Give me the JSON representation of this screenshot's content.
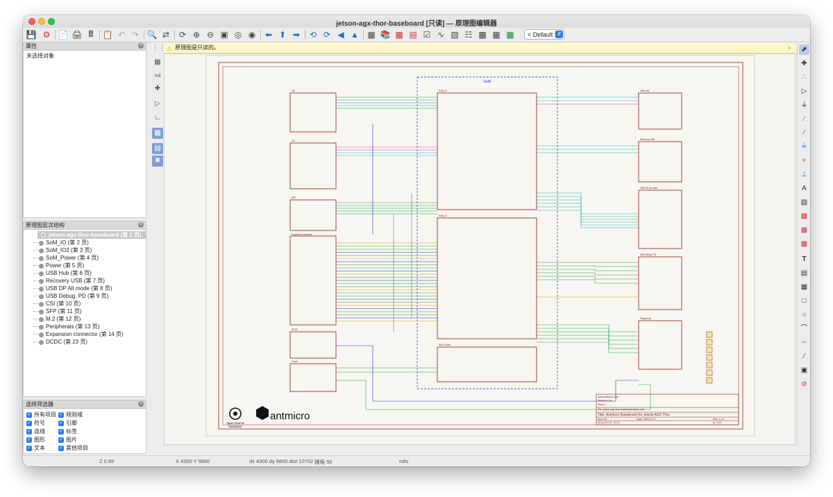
{
  "window": {
    "title": "jetson-agx-thor-baseboard [只读] — 原理图编辑器"
  },
  "toolbar": {
    "layer_select": "< Default >"
  },
  "properties": {
    "title": "属性",
    "empty_text": "未选择对象"
  },
  "hierarchy": {
    "title": "原理图层次结构",
    "root": "jetson-agx-thor-baseboard (第 1 页)",
    "items": [
      "SoM_IO (第 2 页)",
      "SoM_IO2 (第 3 页)",
      "SoM_Power (第 4 页)",
      "Power (第 5 页)",
      "USB Hub (第 6 页)",
      "Recovery USB (第 7 页)",
      "USB DP Alt mode (第 8 页)",
      "USB Debug, PD (第 9 页)",
      "CSI (第 10 页)",
      "SFP (第 11 页)",
      "M.2 (第 12 页)",
      "Peripherals (第 13 页)",
      "Expansion connector (第 14 页)",
      "DCDC (第 23 页)"
    ]
  },
  "filter": {
    "title": "选择筛选器",
    "items": [
      "所有项目",
      "规则域",
      "符号",
      "引脚",
      "连线",
      "标签",
      "图形",
      "图片",
      "文本",
      "其他项目"
    ]
  },
  "banner": {
    "message": "原理图是只读的。"
  },
  "schematic": {
    "som_title": "SoM",
    "blocks": {
      "csi": "CSI",
      "m2": "M.2",
      "sfp": "SFP",
      "exp": "Expansion connector",
      "dcdc": "DCDC",
      "power": "Power",
      "som_io": "SoM_IO",
      "som_io2": "SoM_IO",
      "som_power": "SoM_Power",
      "usbhub": "USB Hub",
      "recovery": "Recovery USB",
      "dpalt": "USB DP Alt mode",
      "debug": "USB Debug, PD",
      "periph": "Peripherals"
    },
    "logo": {
      "osh_line1": "open source",
      "osh_line2": "hardware",
      "antmicro": "antmicro"
    },
    "titleblock": {
      "url": "www.antmicro.com",
      "company": "Antmicro Ltd",
      "sheet": "Sheet: /",
      "file": "File: jetson-agx-thor-baseboard.kicad_sch",
      "title": "Title: Antmicro Baseboard for Jetson AGX Thor",
      "size": "Size: A3",
      "date": "Date: 2026-02-17",
      "rev": "Rev: 1.1.0",
      "kicad": "KiCad E.D.A. 10.0.0",
      "id": "Id: 1/15"
    }
  },
  "status": {
    "zoom": "Z 0.89",
    "xy": "X 4300  Y 9800",
    "delta": "dx 4300  dy 9800  dist 10702",
    "grid": "栅格 50",
    "units": "mils"
  }
}
